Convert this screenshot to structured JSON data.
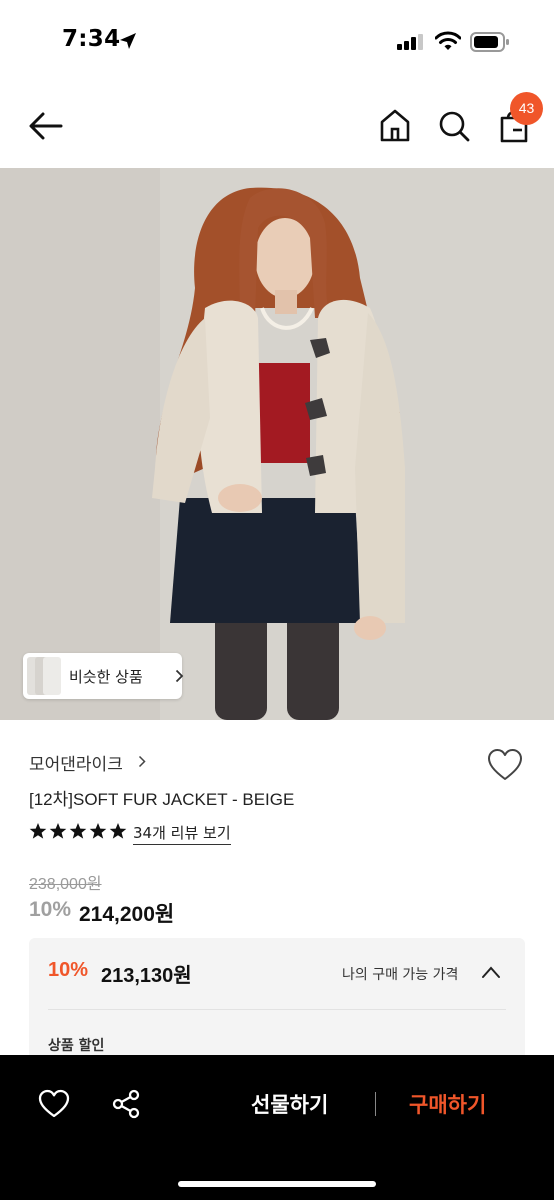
{
  "status_bar": {
    "time": "7:34"
  },
  "header": {
    "cart_count": "43",
    "icons": [
      "back-arrow-icon",
      "home-icon",
      "search-icon",
      "cart-icon"
    ]
  },
  "hero": {
    "similar_products_label": "비슷한 상품"
  },
  "product": {
    "brand": "모어댄라이크",
    "title": "[12차]SOFT FUR JACKET - BEIGE",
    "rating_stars": 5,
    "review_link": "34개 리뷰 보기",
    "original_price": "238,000원",
    "discount_rate": "10%",
    "sale_price": "214,200원"
  },
  "my_price_box": {
    "discount_rate": "10%",
    "price": "213,130원",
    "label": "나의 구매 가능 가격",
    "section_label": "상품 할인"
  },
  "bottom_bar": {
    "gift_label": "선물하기",
    "buy_label": "구매하기"
  },
  "colors": {
    "accent": "#f0562a",
    "bottom_bar_bg": "#000000",
    "price_box_bg": "#f4f4f4"
  }
}
